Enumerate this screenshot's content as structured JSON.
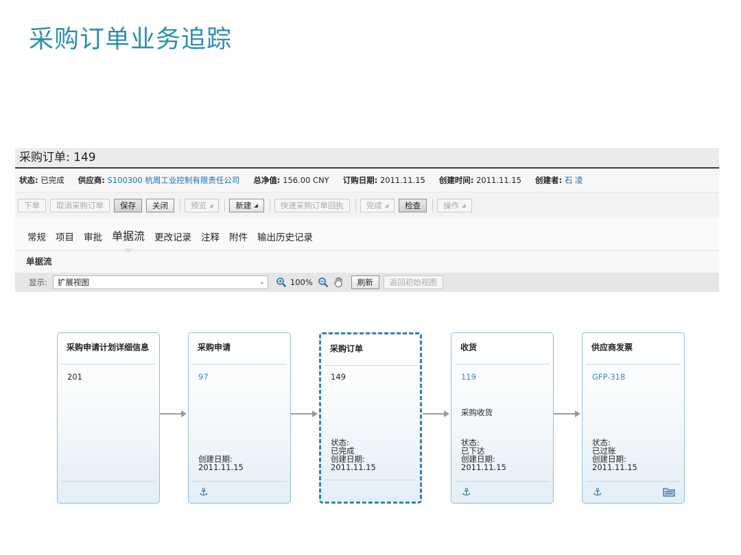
{
  "slide_title": "采购订单业务追踪",
  "window_title": "采购订单: 149",
  "info": {
    "status_label": "状态:",
    "status_value": "已完成",
    "supplier_label": "供应商:",
    "supplier_value": "S100300 杭周工业控制有限责任公司",
    "net_label": "总净值:",
    "net_value": "156.00 CNY",
    "order_date_label": "订购日期:",
    "order_date_value": "2011.11.15",
    "created_time_label": "创建时间:",
    "created_time_value": "2011.11.15",
    "creator_label": "创建者:",
    "creator_value": "石 凌"
  },
  "toolbar": {
    "place_order": "下单",
    "cancel_order": "取消采购订单",
    "save": "保存",
    "close": "关闭",
    "preview": "预览",
    "new": "新建",
    "quick_receipt": "快速采购订单回执",
    "complete": "完成",
    "check": "检查",
    "actions": "操作"
  },
  "tabs": [
    "常规",
    "项目",
    "审批",
    "单据流",
    "更改记录",
    "注释",
    "附件",
    "输出历史记录"
  ],
  "active_tab": "单据流",
  "section_title": "单据流",
  "view": {
    "label": "显示:",
    "selected": "扩展视图",
    "zoom": "100%",
    "refresh": "刷新",
    "reset": "返回初始视图"
  },
  "cards": [
    {
      "title": "采购申请计划详细信息",
      "number": "201",
      "number_is_link": false,
      "mid": "",
      "status_label": "",
      "status_value": "",
      "date_label": "",
      "date_value": "",
      "folder": false
    },
    {
      "title": "采购申请",
      "number": "97",
      "number_is_link": true,
      "mid": "",
      "status_label": "",
      "status_value": "",
      "date_label": "创建日期:",
      "date_value": "2011.11.15",
      "folder": false
    },
    {
      "title": "采购订单",
      "number": "149",
      "number_is_link": false,
      "mid": "",
      "status_label": "状态:",
      "status_value": "已完成",
      "date_label": "创建日期:",
      "date_value": "2011.11.15",
      "folder": false
    },
    {
      "title": "收货",
      "number": "119",
      "number_is_link": true,
      "mid": "采购收货",
      "status_label": "状态:",
      "status_value": "已下达",
      "date_label": "创建日期:",
      "date_value": "2011.11.15",
      "folder": false
    },
    {
      "title": "供应商发票",
      "number": "GFP-318",
      "number_is_link": true,
      "mid": "",
      "status_label": "状态:",
      "status_value": "已过账",
      "date_label": "创建日期:",
      "date_value": "2011.11.15",
      "folder": true
    }
  ],
  "colors": {
    "title": "#2b8fb0",
    "link": "#1a6fb5",
    "card_border": "#8fbecf",
    "current_border": "#2f81b3",
    "anchor": "#2469a1"
  }
}
